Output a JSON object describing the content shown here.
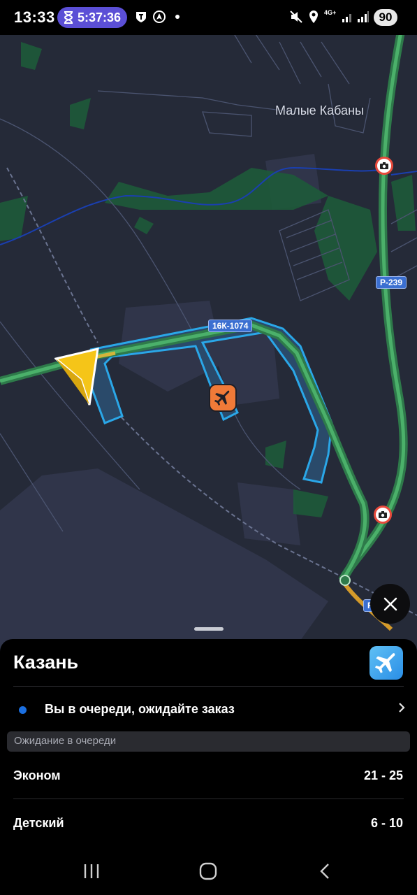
{
  "status_bar": {
    "time": "13:33",
    "timer": "5:37:36",
    "network": "4G+",
    "battery": "90",
    "icons": [
      "hourglass-icon",
      "shield-icon",
      "navigation-icon",
      "dot-icon",
      "mute-icon",
      "location-icon",
      "wifi-signal-icon",
      "cell-signal-icon"
    ]
  },
  "map": {
    "place_label": "Малые Кабаны",
    "route_badges": [
      "16К-1074",
      "Р-239",
      "Р"
    ],
    "icons": [
      "navigation-arrow-icon",
      "airport-icon",
      "speed-camera-icon"
    ]
  },
  "sheet": {
    "title": "Казань",
    "queue_status": "Вы в очереди, ожидайте заказ",
    "section_title": "Ожидание в очереди",
    "tariffs": [
      {
        "name": "Эконом",
        "wait": "21 - 25"
      },
      {
        "name": "Детский",
        "wait": "6 - 10"
      }
    ]
  },
  "colors": {
    "accent_blue": "#1b6fe0",
    "route_green": "#3fa35b",
    "zone_blue": "#2aa7e8",
    "nav_arrow": "#f5c518",
    "airport_pin": "#f07a38"
  },
  "nav_bar": {
    "buttons": [
      "recent-apps-icon",
      "home-icon",
      "back-icon"
    ]
  }
}
